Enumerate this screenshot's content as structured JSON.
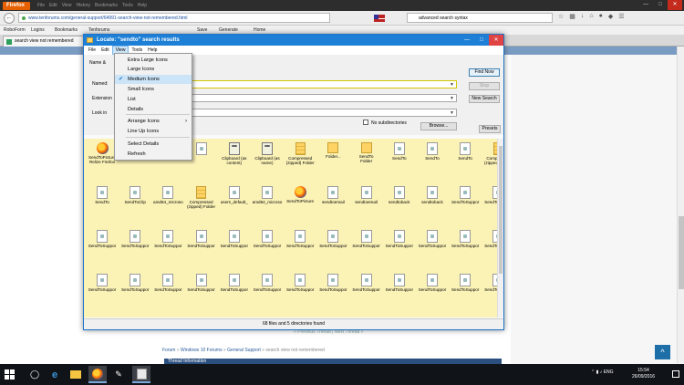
{
  "browser": {
    "app_button": "Firefox",
    "menus": [
      "File",
      "Edit",
      "View",
      "History",
      "Bookmarks",
      "Tools",
      "Help"
    ],
    "url": "www.tenforums.com/general-support/64991-search-view-not-remembered.html",
    "search": "advanced search syntax",
    "bookmarks": [
      "RoboForm",
      "Logins",
      "Bookmarks",
      "Tenforums",
      "Save",
      "Generate",
      "Home"
    ],
    "tab_title": "search view not remembered",
    "tab_close": "x"
  },
  "webpage": {
    "prev_next": "« Previous Thread | Next Thread »",
    "breadcrumb": {
      "forum": "Forum",
      "sep1": " » ",
      "win10": "Windows 10 Forums",
      "sep2": " » ",
      "general": "General Support",
      "sep3": " » ",
      "thread": "search view not remembered"
    },
    "thread_info": "Thread Information"
  },
  "locate": {
    "title": "Locate: \"sendto\" search results",
    "menubar": [
      "File",
      "Edit",
      "View",
      "Tools",
      "Help"
    ],
    "tab_name": "Name &",
    "labels": {
      "named": "Named:",
      "extension": "Extension",
      "lookin": "Look in"
    },
    "buttons": {
      "find_now": "Find Now",
      "stop": "Stop",
      "new_search": "New Search",
      "browse": "Browse...",
      "presets": "Presets"
    },
    "no_subdirs": "No subdirectories",
    "status": "68 files and 5 directories found",
    "view_menu": [
      {
        "label": "Extra Large Icons"
      },
      {
        "label": "Large Icons"
      },
      {
        "label": "Medium Icons",
        "checked": true
      },
      {
        "label": "Small Icons"
      },
      {
        "label": "List"
      },
      {
        "label": "Details"
      },
      {
        "label": "Arrange Icons",
        "submenu": true
      },
      {
        "label": "Line Up Icons"
      },
      {
        "label": "Select Details"
      },
      {
        "label": "Refresh"
      }
    ],
    "results": [
      [
        "SendToPicture\nRelize Firefox",
        "Menu limited)",
        "",
        "",
        "Clipboard (as\ncontent)",
        "Clipboard (as\nname)",
        "Compressed\n(zipped) Folder",
        "Folder...",
        "SendTo\nFolder",
        "SendTo",
        "SendTo",
        "SendTo",
        "Compressed\n(zipped) Folder"
      ],
      [
        "SendTo",
        "SendToClip",
        "amd64_microso",
        "Compressed\n(zipped) Folder",
        "users_default_",
        "amd64_microso",
        "SendToPicture",
        "sendtoemail",
        "sendtoemail",
        "sendtoback",
        "sendtoback",
        "SendToSuppor",
        "SendToSuppor"
      ],
      [
        "SendToSuppor",
        "SendToSuppor",
        "SendToSuppor",
        "SendToSuppor",
        "SendToSuppor",
        "SendToSuppor",
        "SendToSuppor",
        "SendToSuppor",
        "SendToSuppor",
        "SendToSuppor",
        "SendToSuppor",
        "SendToSuppor",
        "SendToSuppor"
      ],
      [
        "SendToSuppor",
        "SendToSuppor",
        "SendToSuppor",
        "SendToSuppor",
        "SendToSuppor",
        "SendToSuppor",
        "SendToSuppor",
        "SendToSuppor",
        "SendToSuppor",
        "SendToSuppor",
        "SendToSuppor",
        "SendToSuppor",
        "SendToSuppor"
      ],
      [
        "SendToAdd",
        "SendToClipboa",
        "SendToClipbo",
        "SendToComma",
        "SendToDefault",
        "SendToFavorit",
        "SendToFolder",
        "SendToQuick",
        "SendToRecycl",
        "SendToRemo",
        "SendToRun",
        "SendToPicture\nRelate Firefox",
        ""
      ],
      [
        "",
        "",
        "",
        "",
        "",
        "",
        "",
        "",
        "",
        "",
        "",
        "",
        ""
      ]
    ],
    "result_icons": [
      [
        "firefox-icon",
        "file-icon",
        "file-icon",
        "file-icon",
        "clipboard-icon",
        "clipboard-icon",
        "zip-folder-icon",
        "folder-icon",
        "folder-icon",
        "file-icon",
        "file-icon",
        "file-icon",
        "zip-folder-icon"
      ],
      [
        "file-icon",
        "file-icon",
        "file-icon",
        "zip-folder-icon",
        "file-icon",
        "file-icon",
        "firefox-icon",
        "file-icon",
        "file-icon",
        "file-icon",
        "file-icon",
        "file-icon",
        "file-icon"
      ],
      [
        "file-icon",
        "file-icon",
        "file-icon",
        "file-icon",
        "file-icon",
        "file-icon",
        "file-icon",
        "file-icon",
        "file-icon",
        "file-icon",
        "file-icon",
        "file-icon",
        "file-icon"
      ],
      [
        "file-icon",
        "file-icon",
        "file-icon",
        "file-icon",
        "file-icon",
        "file-icon",
        "file-icon",
        "file-icon",
        "file-icon",
        "file-icon",
        "file-icon",
        "file-icon",
        "file-icon"
      ],
      [
        "add-icon",
        "file-icon",
        "file-icon",
        "cmd-icon",
        "folder-icon",
        "star-icon",
        "file-icon",
        "file-icon",
        "recycle-bin-icon",
        "file-icon",
        "run-icon",
        "firefox-icon",
        "file-icon"
      ],
      [
        "blue-file-icon",
        "file-icon",
        "file-icon",
        "file-icon",
        "file-icon",
        "file-icon",
        "file-icon",
        "file-icon",
        "file-icon",
        "file-icon",
        "file-icon",
        "file-icon",
        "file-icon"
      ]
    ]
  },
  "taskbar": {
    "language": "ENG",
    "time": "15:54",
    "date": "26/09/2016"
  }
}
